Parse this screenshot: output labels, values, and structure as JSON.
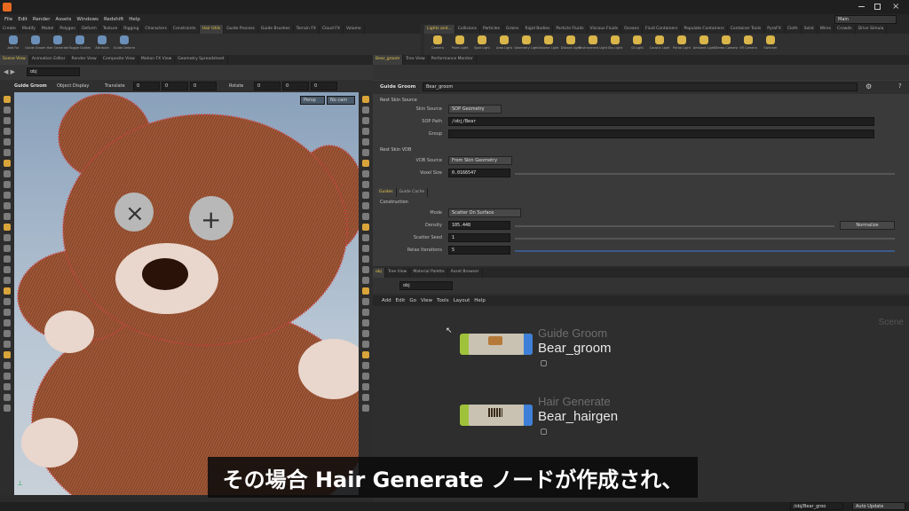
{
  "menu": [
    "File",
    "Edit",
    "Render",
    "Assets",
    "Windows",
    "Redshift",
    "Help"
  ],
  "desktop": "Main",
  "shelf_left": {
    "tabs": [
      "Create",
      "Modify",
      "Model",
      "Polygon",
      "Deform",
      "Texture",
      "Rigging",
      "Characters",
      "Constraints",
      "Hair Utils",
      "Guide Process",
      "Guide Brushes",
      "Terrain FX",
      "Cloud FX",
      "Volume"
    ],
    "active_tab": "Hair Utils",
    "tools": [
      "Add Fur",
      "Guide Groom",
      "Hair Generate",
      "Toggle Guides",
      "Attribute",
      "Guide Deform"
    ]
  },
  "shelf_right": {
    "tabs": [
      "Lights and...",
      "Collisions",
      "Particles",
      "Grains",
      "Rigid Bodies",
      "Particle Fluids",
      "Viscous Fluids",
      "Oceans",
      "Fluid Containers",
      "Populate Containers",
      "Container Tools",
      "PyroFX",
      "Cloth",
      "Solid",
      "Wires",
      "Crowds",
      "Drive Simula"
    ],
    "active_tab": "Lights and...",
    "tools": [
      "Camera",
      "Point Light",
      "Spot Light",
      "Area Light",
      "Geometry Light",
      "Volume Light",
      "Distant Light",
      "Environment Light",
      "Sky Light",
      "GI Light",
      "Caustic Light",
      "Portal Light",
      "Ambient Light",
      "Stereo Camera",
      "VR Camera",
      "Switcher"
    ]
  },
  "viewer": {
    "tabs": [
      "Scene View",
      "Animation Editor",
      "Render View",
      "Composite View",
      "Motion FX View",
      "Geometry Spreadsheet"
    ],
    "path": "obj",
    "tool_name": "Guide Groom",
    "object_display": "Object Display",
    "translate_label": "Translate",
    "translate": [
      "0",
      "0",
      "0"
    ],
    "rotate_label": "Rotate",
    "rotate": [
      "0",
      "0",
      "0"
    ],
    "camera_menu": "Persp",
    "cam_menu": "No cam"
  },
  "params": {
    "tabs": [
      "Bear_groom",
      "Tree View",
      "Performance Monitor"
    ],
    "node_type": "Guide Groom",
    "node_name": "Bear_groom",
    "rest_skin_section": "Rest Skin Source",
    "skin_source_label": "Skin Source",
    "skin_source": "SOP Geometry",
    "sop_path_label": "SOP Path",
    "sop_path": "/obj/Bear",
    "group_label": "Group",
    "group": "",
    "rest_vdb_section": "Rest Skin VDB",
    "vdb_source_label": "VDB Source",
    "vdb_source": "From Skin Geometry",
    "voxel_size_label": "Voxel Size",
    "voxel_size": "0.0166547",
    "subtabs": [
      "Guides",
      "Guide Cache"
    ],
    "construction_section": "Construction",
    "mode_label": "Mode",
    "mode": "Scatter On Surface",
    "density_label": "Density",
    "density": "105.448",
    "density_btn": "Normalize",
    "scatter_seed_label": "Scatter Seed",
    "scatter_seed": "1",
    "relax_label": "Relax Iterations",
    "relax": "5"
  },
  "network": {
    "tabs": [
      "obj",
      "Tree View",
      "Material Palette",
      "Asset Browser"
    ],
    "path": "obj",
    "menu": [
      "Add",
      "Edit",
      "Go",
      "View",
      "Tools",
      "Layout",
      "Help"
    ],
    "context_label": "Scene",
    "nodes": [
      {
        "type": "Guide Groom",
        "name": "Bear_groom"
      },
      {
        "type": "Hair Generate",
        "name": "Bear_hairgen"
      }
    ]
  },
  "subtitle": "その場合 Hair Generate ノードが作成され、",
  "status": {
    "path": "/obj/Bear_groo",
    "auto_update": "Auto Update"
  },
  "colors": {
    "accent": "#e6c84a",
    "node_green": "#9fc23a",
    "node_blue": "#3f7fd8"
  }
}
